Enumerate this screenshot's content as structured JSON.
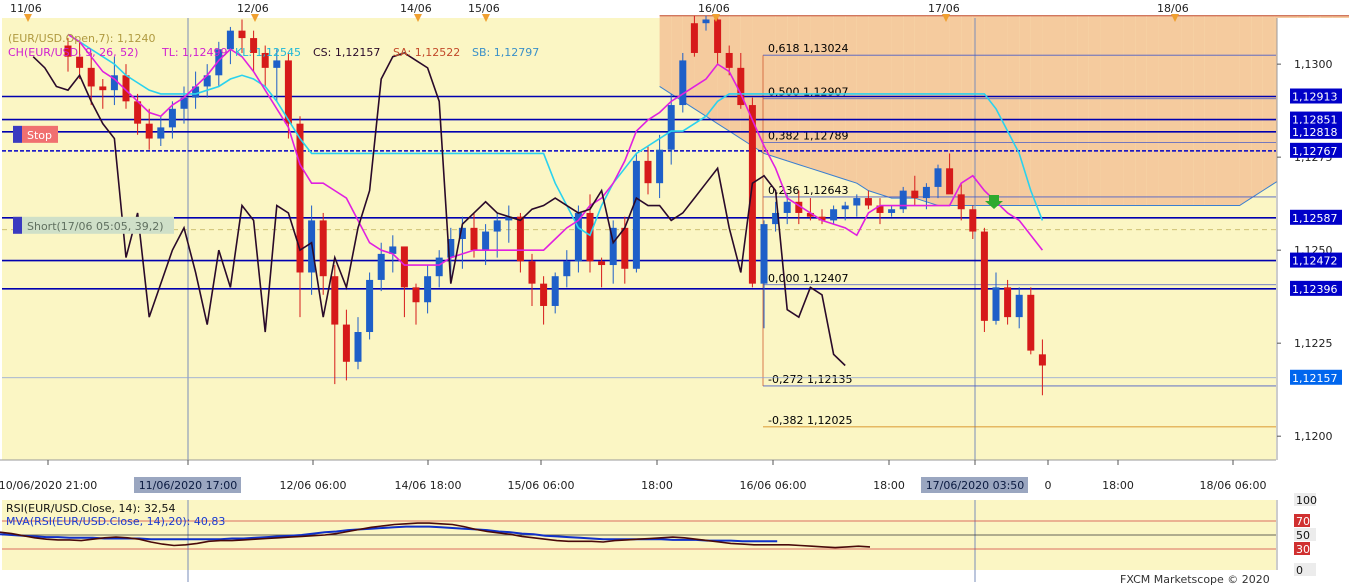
{
  "chart_data": {
    "type": "candlestick",
    "instrument": "EUR/USD",
    "watermark": "FXCM Marketscope © 2020",
    "top_dates": [
      "11/06",
      "12/06",
      "14/06",
      "15/06",
      "16/06",
      "17/06",
      "18/06"
    ],
    "legend": {
      "line1": "CH(EUR/USD, 9, 26, 52) TL: 1,12499  KL: 1,12545  CS: 1,12157  SA: 1,12522  SB: 1,12797",
      "line0": "(EUR/USD.Open,7): 1,1240",
      "tl": "CH(EUR/USD, 9, 26, 52)",
      "tl_val": "TL: 1,12499",
      "kl_val": "KL: 1,12545",
      "cs_val": "CS: 1,12157",
      "sa_val": "SA: 1,12522",
      "sb_val": "SB: 1,12797"
    },
    "y_ticks": [
      "1,1300",
      "1,1275",
      "1,1250",
      "1,1225",
      "1,1200"
    ],
    "y_tick_values": [
      1.13,
      1.1275,
      1.125,
      1.1225,
      1.12
    ],
    "ylim": [
      1.11936,
      1.13124
    ],
    "x_labels": [
      {
        "text": "10/06/2020 21:00",
        "highlight": false
      },
      {
        "text": "11/06/2020 17:00",
        "highlight": true
      },
      {
        "text": "12/06 06:00",
        "highlight": false
      },
      {
        "text": "14/06 18:00",
        "highlight": false
      },
      {
        "text": "15/06 06:00",
        "highlight": false
      },
      {
        "text": "18:00",
        "highlight": false
      },
      {
        "text": "16/06 06:00",
        "highlight": false
      },
      {
        "text": "18:00",
        "highlight": false
      },
      {
        "text": "17/06/2020 03:50",
        "highlight": true
      },
      {
        "text": "0",
        "highlight": false
      },
      {
        "text": "18:00",
        "highlight": false
      },
      {
        "text": "18/06 06:00",
        "highlight": false
      }
    ],
    "level_labels": [
      {
        "text": "1,12913",
        "value": 1.12913,
        "color": "#0000c8"
      },
      {
        "text": "1,12851",
        "value": 1.12851,
        "color": "#0000c8"
      },
      {
        "text": "1,12818",
        "value": 1.12818,
        "color": "#0000c8"
      },
      {
        "text": "1,12767",
        "value": 1.12767,
        "color": "#0000c8"
      },
      {
        "text": "1,12587",
        "value": 1.12587,
        "color": "#0000c8"
      },
      {
        "text": "1,12472",
        "value": 1.12472,
        "color": "#0000c8"
      },
      {
        "text": "1,12396",
        "value": 1.12396,
        "color": "#0000c8"
      },
      {
        "text": "1,12157",
        "value": 1.12157,
        "color": "#0066ee"
      }
    ],
    "fibonacci": [
      {
        "text": "0,618 1,13024",
        "value": 1.13024
      },
      {
        "text": "0,500 1,12907",
        "value": 1.12907
      },
      {
        "text": "0,382 1,12789",
        "value": 1.12789
      },
      {
        "text": "0,236 1,12643",
        "value": 1.12643
      },
      {
        "text": "0,000 1,12407",
        "value": 1.12407
      },
      {
        "text": "-0,272 1,12135",
        "value": 1.12135
      },
      {
        "text": "-0,382 1,12025",
        "value": 1.12025
      }
    ],
    "markers": {
      "stop": "Stop",
      "short": "Short(17/06 05:05, 39,2)"
    },
    "candles": [
      [
        1.1305,
        1.1307,
        1.1298,
        1.1302
      ],
      [
        1.1302,
        1.1306,
        1.1296,
        1.1299
      ],
      [
        1.1299,
        1.1303,
        1.1289,
        1.1294
      ],
      [
        1.1294,
        1.1296,
        1.1288,
        1.1293
      ],
      [
        1.1293,
        1.1302,
        1.1289,
        1.1297
      ],
      [
        1.1297,
        1.13,
        1.1288,
        1.129
      ],
      [
        1.129,
        1.1292,
        1.1281,
        1.1284
      ],
      [
        1.1284,
        1.1288,
        1.1277,
        1.128
      ],
      [
        1.128,
        1.1286,
        1.1278,
        1.1283
      ],
      [
        1.1283,
        1.129,
        1.128,
        1.1288
      ],
      [
        1.1288,
        1.1294,
        1.1284,
        1.1291
      ],
      [
        1.1291,
        1.1298,
        1.1288,
        1.1294
      ],
      [
        1.1294,
        1.13,
        1.1291,
        1.1297
      ],
      [
        1.1297,
        1.1306,
        1.1294,
        1.1304
      ],
      [
        1.1304,
        1.131,
        1.13,
        1.1309
      ],
      [
        1.1309,
        1.1312,
        1.1303,
        1.1307
      ],
      [
        1.1307,
        1.1309,
        1.1298,
        1.1303
      ],
      [
        1.1303,
        1.1305,
        1.1294,
        1.1299
      ],
      [
        1.1299,
        1.1304,
        1.129,
        1.1301
      ],
      [
        1.1301,
        1.1303,
        1.128,
        1.1284
      ],
      [
        1.1284,
        1.1286,
        1.1232,
        1.1244
      ],
      [
        1.1244,
        1.1262,
        1.1238,
        1.1258
      ],
      [
        1.1258,
        1.126,
        1.1238,
        1.1243
      ],
      [
        1.1243,
        1.1246,
        1.1214,
        1.123
      ],
      [
        1.123,
        1.1234,
        1.1215,
        1.122
      ],
      [
        1.122,
        1.1232,
        1.1218,
        1.1228
      ],
      [
        1.1228,
        1.1244,
        1.1226,
        1.1242
      ],
      [
        1.1242,
        1.1252,
        1.1239,
        1.1249
      ],
      [
        1.1249,
        1.1254,
        1.1244,
        1.1251
      ],
      [
        1.1251,
        1.125,
        1.1232,
        1.124
      ],
      [
        1.124,
        1.1241,
        1.123,
        1.1236
      ],
      [
        1.1236,
        1.1246,
        1.1233,
        1.1243
      ],
      [
        1.1243,
        1.125,
        1.124,
        1.1248
      ],
      [
        1.1248,
        1.1256,
        1.1242,
        1.1253
      ],
      [
        1.1253,
        1.1259,
        1.1245,
        1.1256
      ],
      [
        1.1256,
        1.126,
        1.1248,
        1.125
      ],
      [
        1.125,
        1.1257,
        1.1246,
        1.1255
      ],
      [
        1.1255,
        1.126,
        1.1248,
        1.1258
      ],
      [
        1.1258,
        1.1262,
        1.1252,
        1.1259
      ],
      [
        1.1259,
        1.126,
        1.1244,
        1.1247
      ],
      [
        1.1247,
        1.1249,
        1.1235,
        1.1241
      ],
      [
        1.1241,
        1.1243,
        1.123,
        1.1235
      ],
      [
        1.1235,
        1.1244,
        1.1233,
        1.1243
      ],
      [
        1.1243,
        1.125,
        1.124,
        1.1247
      ],
      [
        1.1247,
        1.1262,
        1.1244,
        1.126
      ],
      [
        1.126,
        1.1265,
        1.1244,
        1.1247
      ],
      [
        1.1247,
        1.1248,
        1.124,
        1.1246
      ],
      [
        1.1246,
        1.1258,
        1.1241,
        1.1256
      ],
      [
        1.1256,
        1.1259,
        1.1241,
        1.1245
      ],
      [
        1.1245,
        1.1276,
        1.1244,
        1.1274
      ],
      [
        1.1274,
        1.1278,
        1.1265,
        1.1268
      ],
      [
        1.1268,
        1.1281,
        1.1264,
        1.1277
      ],
      [
        1.1277,
        1.1292,
        1.1273,
        1.1289
      ],
      [
        1.1289,
        1.1303,
        1.1287,
        1.1301
      ],
      [
        1.1311,
        1.1313,
        1.1302,
        1.1303
      ],
      [
        1.1311,
        1.1313,
        1.1309,
        1.1312
      ],
      [
        1.1312,
        1.1313,
        1.13,
        1.1303
      ],
      [
        1.1303,
        1.1305,
        1.1297,
        1.1299
      ],
      [
        1.1299,
        1.1303,
        1.1288,
        1.1289
      ],
      [
        1.1289,
        1.1291,
        1.124,
        1.1241
      ],
      [
        1.1241,
        1.1258,
        1.1229,
        1.1257
      ],
      [
        1.1257,
        1.1263,
        1.1255,
        1.126
      ],
      [
        1.126,
        1.1265,
        1.1257,
        1.1263
      ],
      [
        1.1263,
        1.1266,
        1.1257,
        1.126
      ],
      [
        1.126,
        1.1264,
        1.1258,
        1.1259
      ],
      [
        1.1259,
        1.1261,
        1.1257,
        1.1258
      ],
      [
        1.1258,
        1.1262,
        1.1257,
        1.1261
      ],
      [
        1.1261,
        1.1263,
        1.1258,
        1.1262
      ],
      [
        1.1262,
        1.1265,
        1.1259,
        1.1264
      ],
      [
        1.1264,
        1.1266,
        1.1261,
        1.1262
      ],
      [
        1.1262,
        1.1264,
        1.1257,
        1.126
      ],
      [
        1.126,
        1.1262,
        1.1259,
        1.1261
      ],
      [
        1.1261,
        1.1267,
        1.126,
        1.1266
      ],
      [
        1.1266,
        1.127,
        1.1262,
        1.1264
      ],
      [
        1.1264,
        1.1268,
        1.1261,
        1.1267
      ],
      [
        1.1267,
        1.1273,
        1.1264,
        1.1272
      ],
      [
        1.1272,
        1.1276,
        1.1268,
        1.1265
      ],
      [
        1.1265,
        1.1268,
        1.1258,
        1.1261
      ],
      [
        1.1261,
        1.1262,
        1.1253,
        1.1255
      ],
      [
        1.1255,
        1.1256,
        1.1228,
        1.1231
      ],
      [
        1.1231,
        1.1244,
        1.123,
        1.124
      ],
      [
        1.124,
        1.1242,
        1.123,
        1.1232
      ],
      [
        1.1232,
        1.124,
        1.1229,
        1.1238
      ],
      [
        1.1238,
        1.124,
        1.1222,
        1.1223
      ],
      [
        1.1222,
        1.1226,
        1.1211,
        1.1219
      ]
    ],
    "tenkan": [
      1.1308,
      1.1306,
      1.1302,
      1.1298,
      1.1296,
      1.1293,
      1.129,
      1.1287,
      1.1286,
      1.1289,
      1.1291,
      1.1294,
      1.1297,
      1.1301,
      1.1304,
      1.1302,
      1.1298,
      1.1293,
      1.1288,
      1.1283,
      1.1273,
      1.1268,
      1.1268,
      1.1266,
      1.1264,
      1.1258,
      1.1252,
      1.125,
      1.1249,
      1.1246,
      1.1246,
      1.1246,
      1.1246,
      1.1248,
      1.1249,
      1.125,
      1.125,
      1.125,
      1.125,
      1.125,
      1.125,
      1.125,
      1.1253,
      1.1256,
      1.1258,
      1.1262,
      1.1264,
      1.1268,
      1.1274,
      1.1282,
      1.1285,
      1.1287,
      1.129,
      1.1292,
      1.1294,
      1.1296,
      1.13,
      1.1298,
      1.1292,
      1.1285,
      1.1278,
      1.1272,
      1.1264,
      1.1262,
      1.126,
      1.1258,
      1.1257,
      1.1256,
      1.1254,
      1.126,
      1.1262,
      1.1262,
      1.1262,
      1.1262,
      1.1262,
      1.1262,
      1.1262,
      1.1268,
      1.127,
      1.1266,
      1.1263,
      1.126,
      1.1258,
      1.1254,
      1.125
    ],
    "kijun": [
      1.1308,
      1.1306,
      1.1304,
      1.1302,
      1.13,
      1.1297,
      1.1295,
      1.1293,
      1.1292,
      1.1292,
      1.1292,
      1.1292,
      1.1293,
      1.1294,
      1.1296,
      1.1297,
      1.1296,
      1.1294,
      1.129,
      1.1285,
      1.128,
      1.1276,
      1.1276,
      1.1276,
      1.1276,
      1.1276,
      1.1276,
      1.1276,
      1.1276,
      1.1276,
      1.1276,
      1.1276,
      1.1276,
      1.1276,
      1.1276,
      1.1276,
      1.1276,
      1.1276,
      1.1276,
      1.1276,
      1.1276,
      1.1276,
      1.1268,
      1.1262,
      1.1256,
      1.1254,
      1.1262,
      1.1268,
      1.1272,
      1.1276,
      1.1278,
      1.128,
      1.1282,
      1.1282,
      1.1284,
      1.1286,
      1.129,
      1.1292,
      1.1292,
      1.1292,
      1.1292,
      1.1292,
      1.1292,
      1.1292,
      1.1292,
      1.1292,
      1.1292,
      1.1292,
      1.1292,
      1.1292,
      1.1292,
      1.1292,
      1.1292,
      1.1292,
      1.1292,
      1.1292,
      1.1292,
      1.1292,
      1.1292,
      1.1292,
      1.1288,
      1.1282,
      1.1276,
      1.1266,
      1.1258
    ],
    "chikou": [
      1.1302,
      1.1299,
      1.1294,
      1.1293,
      1.1297,
      1.129,
      1.1284,
      1.128,
      1.1248,
      1.126,
      1.1232,
      1.1241,
      1.125,
      1.1256,
      1.1244,
      1.123,
      1.125,
      1.124,
      1.1262,
      1.1258,
      1.1228,
      1.1262,
      1.126,
      1.125,
      1.1252,
      1.1232,
      1.1248,
      1.124,
      1.1256,
      1.1266,
      1.1296,
      1.1302,
      1.1303,
      1.1301,
      1.1299,
      1.129,
      1.1241,
      1.1257,
      1.126,
      1.1263,
      1.126,
      1.1259,
      1.1258,
      1.1261,
      1.1262,
      1.1264,
      1.1262,
      1.126,
      1.1261,
      1.1266,
      1.1252,
      1.1256,
      1.1264,
      1.1262,
      1.1262,
      1.1258,
      1.126,
      1.1264,
      1.1268,
      1.1272,
      1.1256,
      1.1244,
      1.1268,
      1.127,
      1.1266,
      1.1234,
      1.1232,
      1.124,
      1.1238,
      1.1222,
      1.1219
    ],
    "senkou_a": [
      1.1294,
      1.1292,
      1.129,
      1.1288,
      1.1286,
      1.1284,
      1.1282,
      1.128,
      1.1278,
      1.1276,
      1.1275,
      1.1274,
      1.1273,
      1.1272,
      1.1271,
      1.127,
      1.1269,
      1.1268,
      1.1266,
      1.1265,
      1.1264,
      1.1264,
      1.1264,
      1.1263,
      1.1262,
      1.1262,
      1.1262,
      1.1262,
      1.1262,
      1.1262,
      1.1262,
      1.1262,
      1.1262,
      1.1262,
      1.1262,
      1.1262,
      1.1262,
      1.1262,
      1.1262,
      1.1262,
      1.1262,
      1.1262,
      1.1262,
      1.1262,
      1.1262,
      1.1262,
      1.1262,
      1.1262,
      1.1262,
      1.1262,
      1.1262,
      1.1264,
      1.1266,
      1.1268,
      1.127,
      1.1272,
      1.1274,
      1.1276,
      1.1278,
      1.1281,
      1.1283,
      1.1285,
      1.1287,
      1.1289,
      1.1291,
      1.1293,
      1.1295,
      1.1297,
      1.1299,
      1.1301,
      1.1303,
      1.1305,
      1.1307,
      1.1309,
      1.1311,
      1.1313,
      1.1313,
      1.1313,
      1.1313,
      1.1313,
      1.1313,
      1.1313,
      1.1313,
      1.131,
      1.1305,
      1.13,
      1.1294,
      1.1288,
      1.1283,
      1.128,
      1.1279,
      1.1279,
      1.128,
      1.128,
      1.128,
      1.128,
      1.128,
      1.128,
      1.128,
      1.128,
      1.128,
      1.128,
      1.128,
      1.1281,
      1.1282,
      1.1283,
      1.1285,
      1.1287,
      1.1289,
      1.129,
      1.129,
      1.1289,
      1.1289
    ],
    "senkou_b": [
      1.1313,
      1.1313,
      1.1313,
      1.1313,
      1.1313,
      1.1313,
      1.1313,
      1.1313,
      1.1313,
      1.1313,
      1.1313,
      1.1313,
      1.1313,
      1.1313,
      1.1313,
      1.1313,
      1.1313,
      1.1313,
      1.1313,
      1.1313,
      1.1313,
      1.1313,
      1.1313,
      1.1313,
      1.1313,
      1.1313,
      1.1313,
      1.1313,
      1.1313,
      1.1313,
      1.1313,
      1.1313,
      1.1313,
      1.1313,
      1.1313,
      1.1313,
      1.1313,
      1.1313,
      1.1313,
      1.1313,
      1.1313,
      1.1313,
      1.1313,
      1.1313,
      1.1313,
      1.1313,
      1.1313,
      1.1313,
      1.1313,
      1.1313,
      1.1313,
      1.1313,
      1.1313,
      1.1313,
      1.1313,
      1.1313,
      1.1313,
      1.1313,
      1.1313,
      1.1313,
      1.1313,
      1.1313,
      1.1313,
      1.1313,
      1.1313,
      1.1313,
      1.1313,
      1.1313,
      1.1313,
      1.1313,
      1.1313,
      1.1313,
      1.1313,
      1.1313,
      1.1313,
      1.1313,
      1.1313,
      1.1313,
      1.1313,
      1.1313,
      1.1313,
      1.1313,
      1.1313,
      1.1313,
      1.1313,
      1.1313,
      1.1313,
      1.1313,
      1.1313,
      1.1305,
      1.1297,
      1.129,
      1.1285,
      1.128,
      1.1276,
      1.1276,
      1.1276,
      1.1276,
      1.1276,
      1.1276,
      1.1276,
      1.1276,
      1.1276,
      1.1276,
      1.1276,
      1.1276,
      1.1276,
      1.1274,
      1.1272,
      1.127,
      1.1268,
      1.1266,
      1.1264,
      1.1262,
      1.126
    ],
    "rsi": {
      "label": "RSI(EUR/USD.Close, 14): 32,54",
      "mva_label": "MVA(RSI(EUR/USD.Close, 14),20): 40,83",
      "ticks": [
        "100",
        "70",
        "50",
        "30",
        "0"
      ],
      "values": [
        54,
        52,
        49,
        46,
        44,
        43,
        43,
        42,
        44,
        46,
        47,
        46,
        44,
        40,
        37,
        35,
        36,
        38,
        41,
        42,
        42,
        43,
        44,
        45,
        46,
        47,
        48,
        49,
        50,
        52,
        55,
        58,
        61,
        63,
        65,
        66,
        67,
        67,
        66,
        65,
        62,
        58,
        55,
        53,
        51,
        48,
        46,
        44,
        42,
        41,
        41,
        41,
        40,
        42,
        43,
        44,
        45,
        46,
        47,
        46,
        44,
        42,
        40,
        38,
        37,
        36,
        36,
        36,
        36,
        35,
        34,
        33,
        32,
        33,
        34,
        33
      ],
      "mva": [
        51,
        50,
        49,
        48,
        47,
        47,
        46,
        46,
        46,
        45,
        45,
        45,
        45,
        44,
        44,
        44,
        44,
        44,
        44,
        44,
        45,
        45,
        46,
        47,
        48,
        49,
        50,
        52,
        54,
        55,
        57,
        58,
        59,
        60,
        61,
        62,
        62,
        62,
        61,
        60,
        59,
        58,
        57,
        55,
        54,
        52,
        51,
        49,
        48,
        47,
        46,
        45,
        44,
        44,
        44,
        44,
        44,
        44,
        43,
        43,
        43,
        42,
        42,
        42,
        41,
        41,
        41,
        41
      ]
    }
  }
}
